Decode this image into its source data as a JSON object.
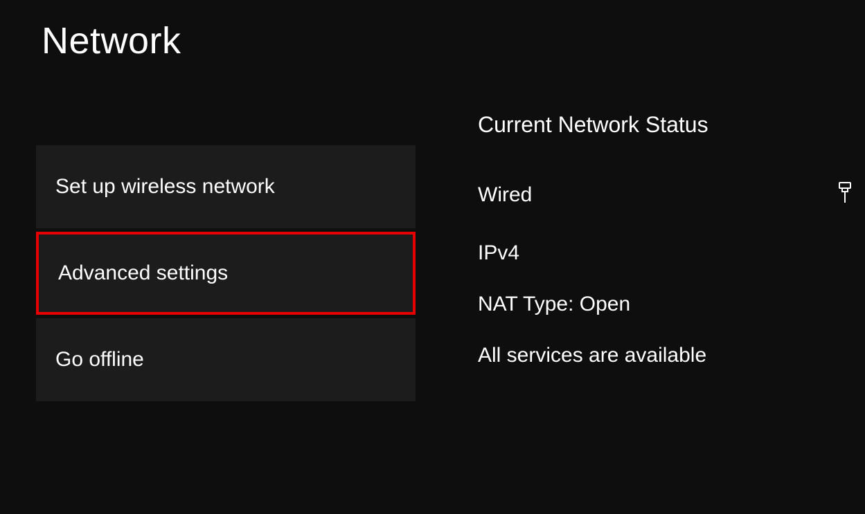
{
  "page": {
    "title": "Network"
  },
  "menu": {
    "items": [
      {
        "label": "Set up wireless network",
        "highlighted": false
      },
      {
        "label": "Advanced settings",
        "highlighted": true
      },
      {
        "label": "Go offline",
        "highlighted": false
      }
    ]
  },
  "status": {
    "heading": "Current Network Status",
    "connection_type": "Wired",
    "connection_icon": "ethernet-icon",
    "ip_version": "IPv4",
    "nat_type": "NAT Type: Open",
    "services": "All services are available"
  }
}
